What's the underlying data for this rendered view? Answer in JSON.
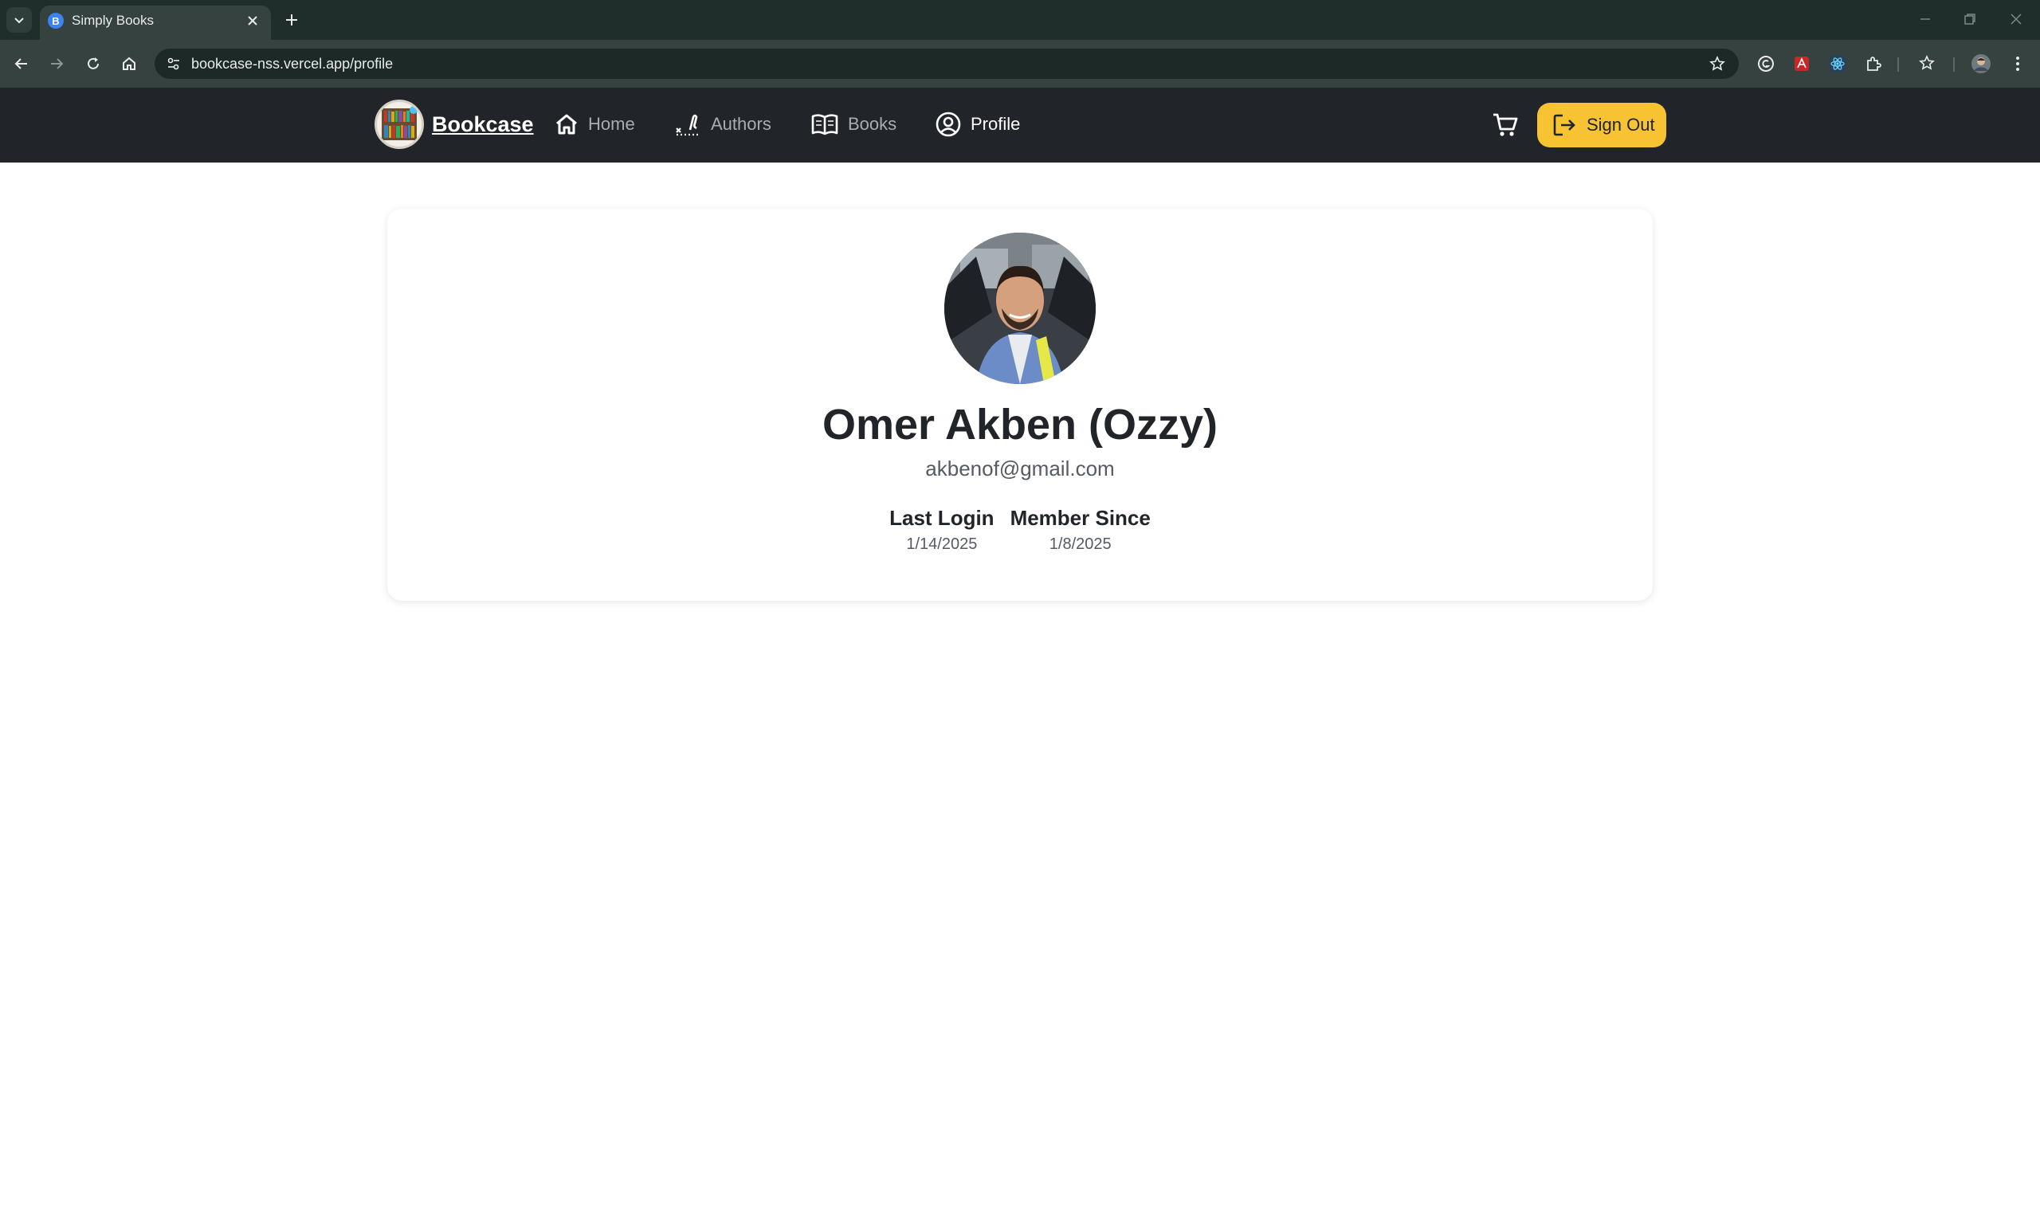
{
  "browser": {
    "tab_title": "Simply Books",
    "tab_favicon_letter": "B",
    "url": "bookcase-nss.vercel.app/profile"
  },
  "nav": {
    "brand": "Bookcase",
    "links": [
      {
        "label": "Home",
        "icon": "home-icon"
      },
      {
        "label": "Authors",
        "icon": "pen-icon"
      },
      {
        "label": "Books",
        "icon": "book-icon"
      },
      {
        "label": "Profile",
        "icon": "user-circle-icon",
        "active": true
      }
    ],
    "cart_icon": "cart-icon",
    "signout_label": "Sign Out",
    "signout_color": "#f8c332"
  },
  "profile": {
    "name": "Omer Akben (Ozzy)",
    "email": "akbenof@gmail.com",
    "last_login_label": "Last Login",
    "last_login_value": "1/14/2025",
    "member_since_label": "Member Since",
    "member_since_value": "1/8/2025"
  }
}
